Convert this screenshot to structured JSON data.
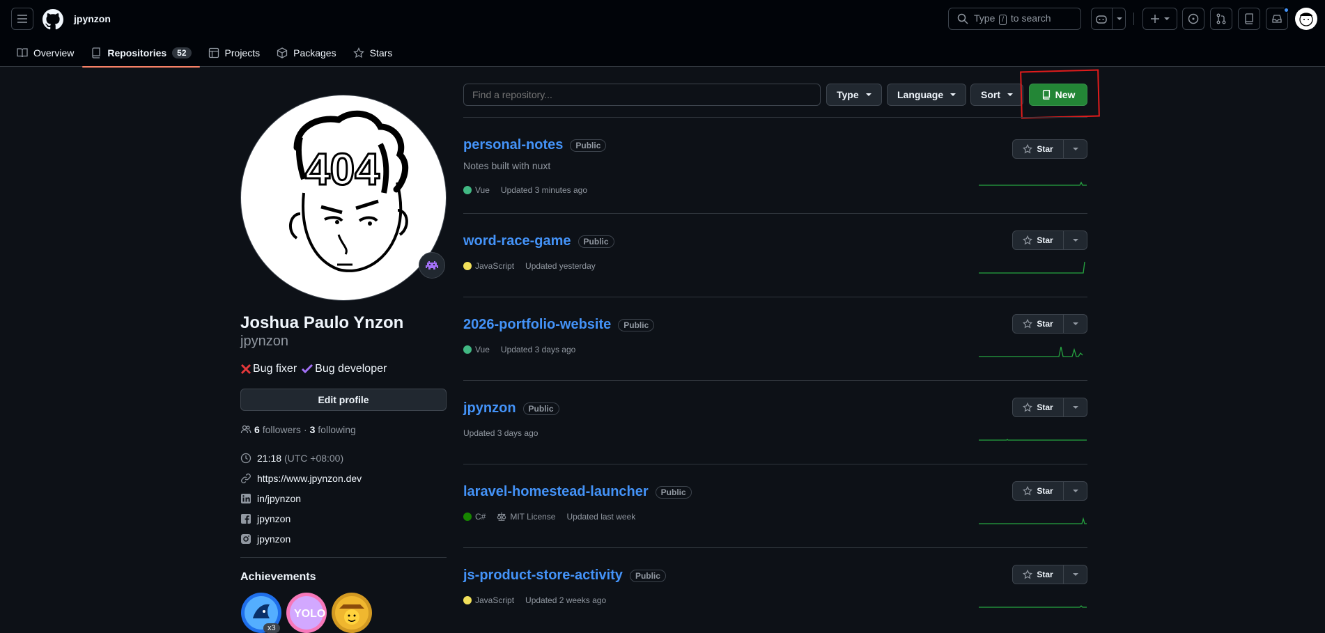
{
  "header": {
    "username": "jpynzon",
    "search_placeholder_parts": [
      "Type",
      "/",
      "to search"
    ]
  },
  "tabs": [
    {
      "label": "Overview"
    },
    {
      "label": "Repositories",
      "count": "52"
    },
    {
      "label": "Projects"
    },
    {
      "label": "Packages"
    },
    {
      "label": "Stars"
    }
  ],
  "profile": {
    "full_name": "Joshua Paulo Ynzon",
    "login": "jpynzon",
    "bio_parts": [
      "Bug fixer",
      "Bug developer"
    ],
    "edit_label": "Edit profile",
    "followers": "6",
    "followers_label": "followers",
    "following": "3",
    "following_label": "following",
    "time": "21:18",
    "timezone": "(UTC +08:00)",
    "website": "https://www.jpynzon.dev",
    "linkedin": "in/jpynzon",
    "facebook": "jpynzon",
    "instagram": "jpynzon",
    "achievements_title": "Achievements",
    "achievement_count": "x3"
  },
  "filters": {
    "search_placeholder": "Find a repository...",
    "type_label": "Type",
    "language_label": "Language",
    "sort_label": "Sort",
    "new_label": "New"
  },
  "colors": {
    "accent_green": "#238636",
    "link_blue": "#4493f8",
    "vue": "#41b883",
    "javascript": "#f1e05a",
    "csharp": "#178600"
  },
  "repos": [
    {
      "name": "personal-notes",
      "visibility": "Public",
      "description": "Notes built with nuxt",
      "language": "Vue",
      "updated": "Updated 3 minutes ago",
      "star_label": "Star"
    },
    {
      "name": "word-race-game",
      "visibility": "Public",
      "description": "",
      "language": "JavaScript",
      "updated": "Updated yesterday",
      "star_label": "Star"
    },
    {
      "name": "2026-portfolio-website",
      "visibility": "Public",
      "description": "",
      "language": "Vue",
      "updated": "Updated 3 days ago",
      "star_label": "Star"
    },
    {
      "name": "jpynzon",
      "visibility": "Public",
      "description": "",
      "language": "",
      "updated": "Updated 3 days ago",
      "star_label": "Star"
    },
    {
      "name": "laravel-homestead-launcher",
      "visibility": "Public",
      "description": "",
      "language": "C#",
      "license": "MIT License",
      "updated": "Updated last week",
      "star_label": "Star"
    },
    {
      "name": "js-product-store-activity",
      "visibility": "Public",
      "description": "",
      "language": "JavaScript",
      "updated": "Updated 2 weeks ago",
      "star_label": "Star"
    }
  ]
}
